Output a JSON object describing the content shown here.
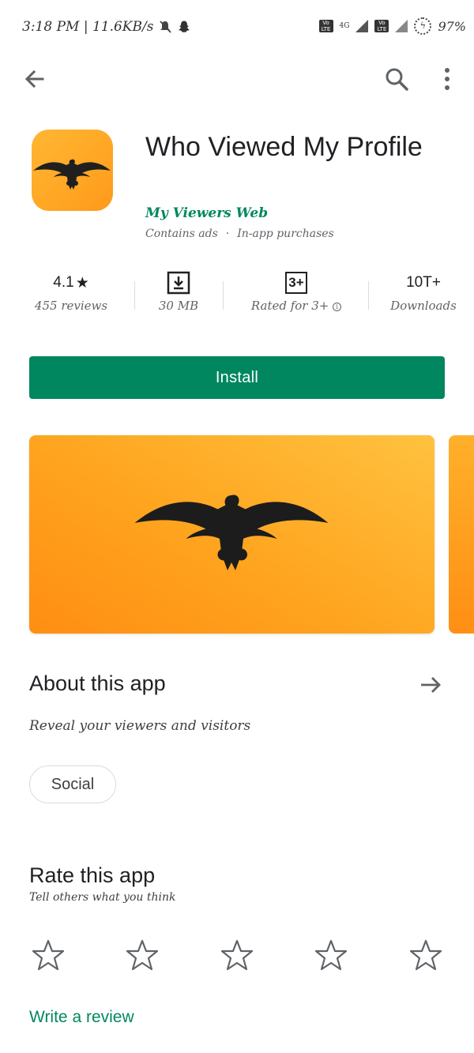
{
  "status_bar": {
    "time_speed": "3:18 PM | 11.6KB/s",
    "network": "4G",
    "volte": "Vo LTE",
    "battery": "97%"
  },
  "toolbar": {
    "back_icon": "arrow-left-icon",
    "search_icon": "search-icon",
    "more_icon": "more-vert-icon"
  },
  "app": {
    "title": "Who Viewed My Profile",
    "developer": "My Viewers Web",
    "contains_ads": "Contains ads",
    "separator": "·",
    "in_app": "In-app purchases",
    "icon_color": "#ffa62b"
  },
  "stats": {
    "rating": "4.1",
    "rating_star": "★",
    "reviews": "455 reviews",
    "size": "30 MB",
    "content_rating_badge": "3+",
    "content_rating_label": "Rated for 3+",
    "downloads": "10T+",
    "downloads_label": "Downloads"
  },
  "install_label": "Install",
  "about": {
    "title": "About this app",
    "description": "Reveal your viewers and visitors",
    "tag": "Social"
  },
  "rate": {
    "title": "Rate this app",
    "subtitle": "Tell others what you think",
    "stars": 5
  },
  "write_review_label": "Write a review",
  "colors": {
    "accent": "#01875f",
    "text": "#202124",
    "secondary": "#5f6368",
    "banner_orange": "#ffa41f"
  }
}
